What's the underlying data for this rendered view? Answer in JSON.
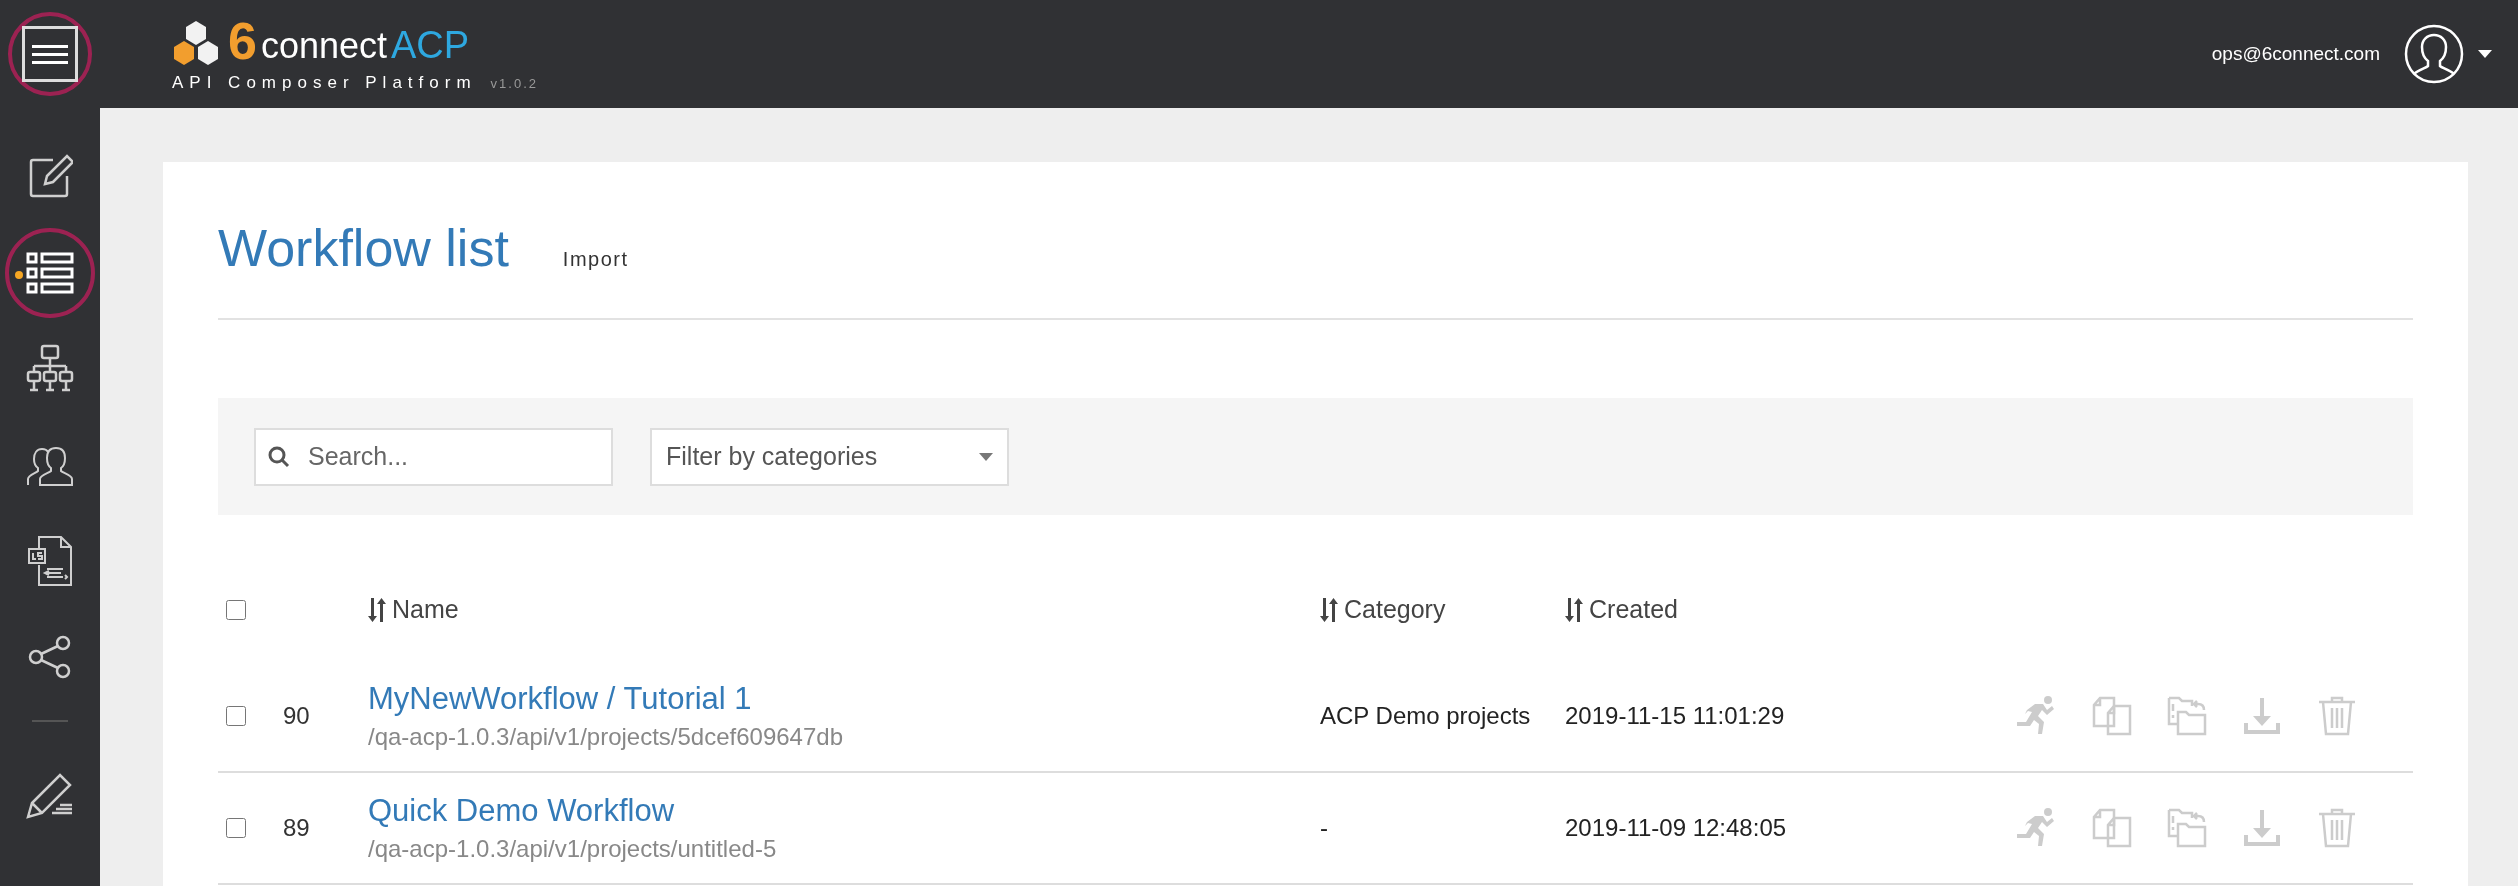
{
  "header": {
    "menu_button": {
      "circled": true
    },
    "logo": {
      "brand_number": "6",
      "brand_word": "connect",
      "brand_product": "ACP",
      "tagline": "API Composer Platform",
      "version": "v1.0.2"
    },
    "user": {
      "email": "ops@6connect.com"
    }
  },
  "sidebar": {
    "items": [
      {
        "kind": "edit",
        "selected": false,
        "circled": false
      },
      {
        "kind": "list",
        "selected": true,
        "circled": true
      },
      {
        "kind": "hierarchy",
        "selected": false,
        "circled": false
      },
      {
        "kind": "users",
        "selected": false,
        "circled": false
      },
      {
        "kind": "script",
        "selected": false,
        "circled": false
      },
      {
        "kind": "share",
        "selected": false,
        "circled": false
      },
      {
        "kind": "separator"
      },
      {
        "kind": "pen",
        "selected": false,
        "circled": false
      }
    ]
  },
  "page": {
    "title": "Workflow list",
    "import_link": "Import",
    "search": {
      "placeholder": "Search..."
    },
    "category_filter": {
      "value": "Filter by categories"
    },
    "table": {
      "select_all": {
        "checked": false
      },
      "columns": [
        "Name",
        "Category",
        "Created"
      ],
      "rows": [
        {
          "checked": false,
          "id": "90",
          "name": "MyNewWorkflow / Tutorial 1",
          "path": "/qa-acp-1.0.3/api/v1/projects/5dcef609647db",
          "category": "ACP Demo projects",
          "created": "2019-11-15 11:01:29"
        },
        {
          "checked": false,
          "id": "89",
          "name": "Quick Demo Workflow",
          "path": "/qa-acp-1.0.3/api/v1/projects/untitled-5",
          "category": "-",
          "created": "2019-11-09 12:48:05"
        }
      ]
    }
  }
}
